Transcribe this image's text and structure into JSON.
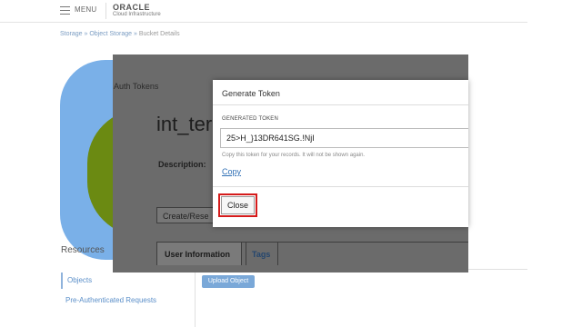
{
  "header": {
    "menu_label": "MENU",
    "brand": "ORACLE",
    "brand_sub": "Cloud Infrastructure"
  },
  "breadcrumb": {
    "storage": "Storage",
    "sep1": " » ",
    "object_storage": "Object Storage",
    "sep2": " » ",
    "current": "Bucket Details"
  },
  "background": {
    "resources_heading": "Resources",
    "nav_objects": "Objects",
    "nav_par": "Pre-Authenticated Requests",
    "upload_button": "Upload Object"
  },
  "auth_panel": {
    "title": "Auth Tokens",
    "user_name": "int_ter",
    "description_label": "Description:",
    "create_button": "Create/Rese",
    "tab_user_info": "User Information",
    "tab_tags": "Tags"
  },
  "dialog": {
    "title": "Generate Token",
    "field_label": "GENERATED TOKEN",
    "token_value": "25>H_}13DR641SG.!NjI",
    "help_text": "Copy this token for your records. It will not be shown again.",
    "copy_link": "Copy",
    "close_button": "Close"
  },
  "colors": {
    "highlight": "#d51b1b",
    "link": "#2f6fb5",
    "overlay": "#6b6b6b"
  }
}
